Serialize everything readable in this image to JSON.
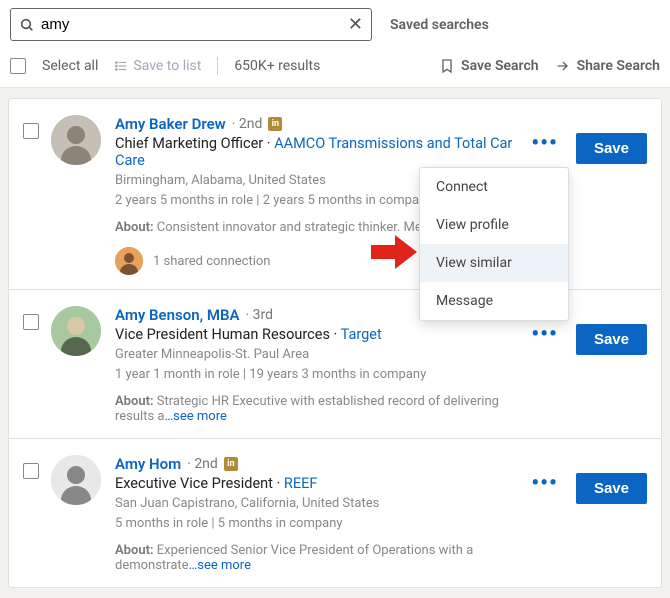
{
  "search": {
    "value": "amy",
    "placeholder": "Search",
    "saved_searches": "Saved searches"
  },
  "toolbar": {
    "select_all": "Select all",
    "save_to_list": "Save to list",
    "results_count": "650K+ results",
    "save_search": "Save Search",
    "share_search": "Share Search"
  },
  "dropdown": {
    "items": [
      "Connect",
      "View profile",
      "View similar",
      "Message"
    ]
  },
  "results": [
    {
      "name": "Amy Baker Drew",
      "degree": "· 2nd",
      "has_badge": true,
      "title": "Chief Marketing Officer",
      "company": "AAMCO Transmissions and Total Car Care",
      "location": "Birmingham, Alabama, United States",
      "tenure": "2 years 5 months in role | 2 years 5 months in company",
      "about": "Consistent innovator and strategic thinker. Mentor and r",
      "shared": "1 shared connection",
      "save": "Save"
    },
    {
      "name": "Amy Benson, MBA",
      "degree": "· 3rd",
      "has_badge": false,
      "title": "Vice President Human Resources",
      "company": "Target",
      "location": "Greater Minneapolis-St. Paul Area",
      "tenure": "1 year 1 month in role | 19 years 3 months in company",
      "about": "Strategic HR Executive with established record of delivering results a",
      "see_more": "…see more",
      "save": "Save"
    },
    {
      "name": "Amy Hom",
      "degree": "· 2nd",
      "has_badge": true,
      "title": "Executive Vice President",
      "company": "REEF",
      "location": "San Juan Capistrano, California, United States",
      "tenure": "5 months in role | 5 months in company",
      "about": "Experienced Senior Vice President of Operations with a demonstrate",
      "see_more": "…see more",
      "save": "Save"
    }
  ],
  "about_label": "About:"
}
